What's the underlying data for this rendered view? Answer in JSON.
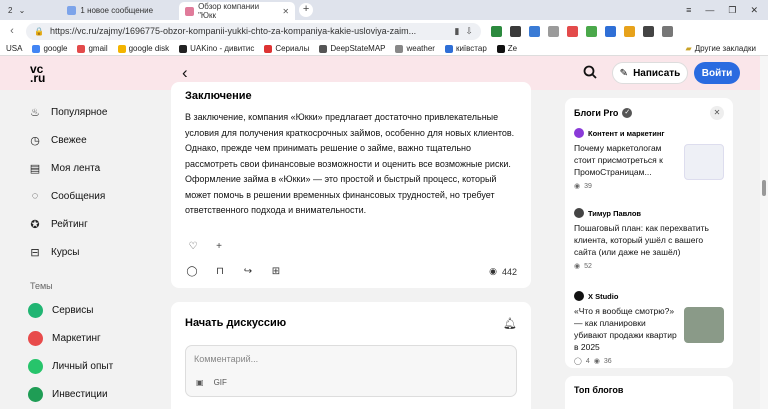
{
  "browser": {
    "tab_count": "2",
    "tabs": [
      {
        "label": "1 новое сообщение"
      },
      {
        "label": "Обзор компании \"Юкк"
      }
    ],
    "new_tab": "+",
    "url_main": "https://vc.ru/zajmy/1696775-obzor-kompanii-yukki-chto-za-kompaniya-kakie-usloviya-zaim...",
    "bookmarks": [
      "USA",
      "google",
      "gmail",
      "google disk",
      "UAKino - дивитис",
      "Сериалы",
      "DeepStateMAP",
      "weather",
      "київстар",
      "Ze"
    ],
    "other_bookmarks": "Другие закладки"
  },
  "header": {
    "logo_top": "vc",
    "logo_bottom": ".ru",
    "write": "Написать",
    "login": "Войти"
  },
  "sidenav": [
    "Популярное",
    "Свежее",
    "Моя лента",
    "Сообщения",
    "Рейтинг",
    "Курсы"
  ],
  "topics_title": "Темы",
  "topics": [
    {
      "label": "Сервисы",
      "color": "#21b573"
    },
    {
      "label": "Маркетинг",
      "color": "#e84b4b"
    },
    {
      "label": "Личный опыт",
      "color": "#27c46b"
    },
    {
      "label": "Инвестиции",
      "color": "#1f9d55"
    }
  ],
  "article": {
    "title": "Заключение",
    "text": "В заключение, компания «Юкки» предлагает достаточно привлекательные условия для получения краткосрочных займов, особенно для новых клиентов. Однако, прежде чем принимать решение о займе, важно тщательно рассмотреть свои финансовые возможности и оценить все возможные риски. Оформление займа в «Юкки» — это простой и быстрый процесс, который может помочь в решении временных финансовых трудностей, но требует ответственного подхода и внимательности.",
    "views": "442"
  },
  "discussion": {
    "title": "Начать дискуссию",
    "placeholder": "Комментарий...",
    "gif": "GIF"
  },
  "blogs": {
    "title": "Блоги Pro",
    "posts": [
      {
        "author": "Контент и маркетинг",
        "title": "Почему маркетологам стоит присмотреться к ПромоСтраницам...",
        "views": "39"
      },
      {
        "author": "Тимур Павлов",
        "title": "Пошаговый план: как перехватить клиента, который ушёл с вашего сайта (или даже не зашёл)",
        "views": "52"
      },
      {
        "author": "X Studio",
        "title": "«Что я вообще смотрю?» — как планировки убивают продажи квартир в 2025",
        "comments": "4",
        "views": "36"
      }
    ]
  },
  "top_blogs": "Топ блогов"
}
